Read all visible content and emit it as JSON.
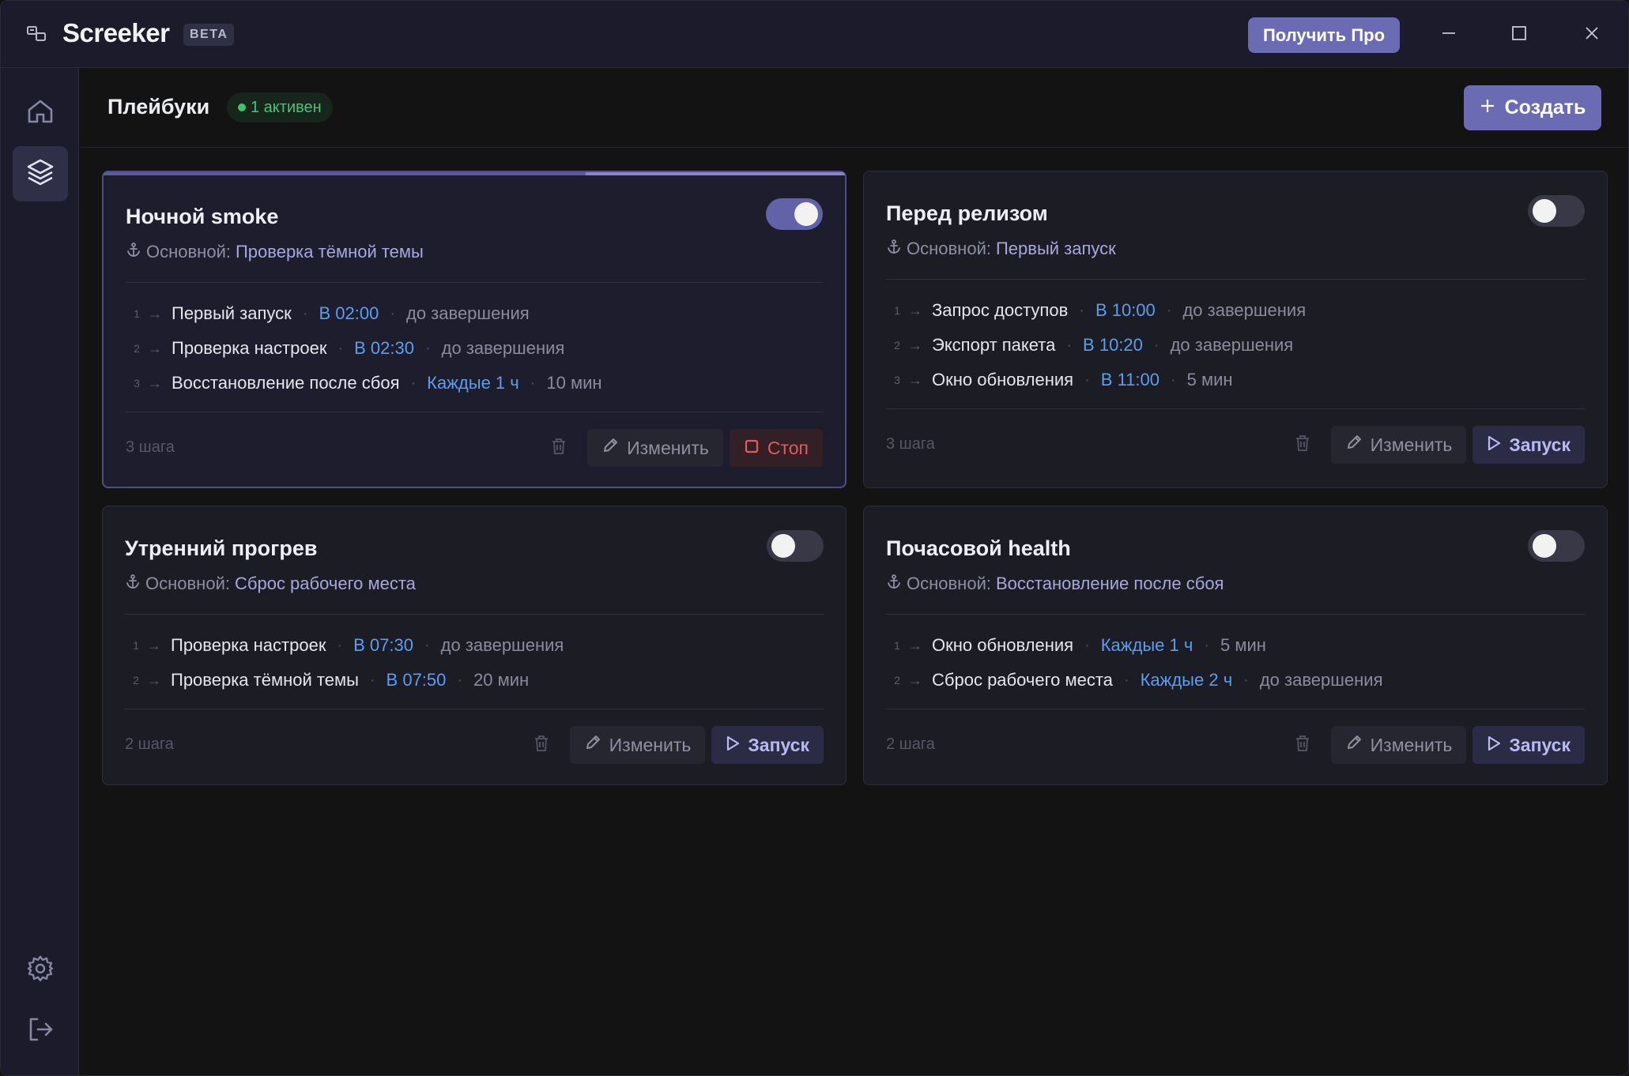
{
  "titlebar": {
    "app_name": "Screeker",
    "beta": "BETA",
    "pro_button": "Получить Про",
    "icons": [
      "app-logo-icon",
      "minimize-icon",
      "maximize-icon",
      "close-icon"
    ]
  },
  "sidebar": {
    "items": [
      {
        "name": "home",
        "icon": "home-icon",
        "active": false
      },
      {
        "name": "playbooks",
        "icon": "layers-icon",
        "active": true
      },
      {
        "name": "settings",
        "icon": "gear-icon",
        "active": false
      },
      {
        "name": "logout",
        "icon": "logout-icon",
        "active": false
      }
    ]
  },
  "header": {
    "title": "Плейбуки",
    "active_badge": "1 активен",
    "create_button": "Создать"
  },
  "labels": {
    "main_prefix": "Основной:",
    "edit": "Изменить",
    "run": "Запуск",
    "stop": "Стоп"
  },
  "cards": [
    {
      "title": "Ночной smoke",
      "enabled": true,
      "running": true,
      "progress": 0.65,
      "main": "Проверка тёмной темы",
      "steps": [
        {
          "num": "1",
          "name": "Первый запуск",
          "when": "В 02:00",
          "duration": "до завершения"
        },
        {
          "num": "2",
          "name": "Проверка настроек",
          "when": "В 02:30",
          "duration": "до завершения"
        },
        {
          "num": "3",
          "name": "Восстановление после сбоя",
          "when": "Каждые 1 ч",
          "duration": "10 мин"
        }
      ],
      "steps_count": "3 шага"
    },
    {
      "title": "Перед релизом",
      "enabled": false,
      "running": false,
      "main": "Первый запуск",
      "steps": [
        {
          "num": "1",
          "name": "Запрос доступов",
          "when": "В 10:00",
          "duration": "до завершения"
        },
        {
          "num": "2",
          "name": "Экспорт пакета",
          "when": "В 10:20",
          "duration": "до завершения"
        },
        {
          "num": "3",
          "name": "Окно обновления",
          "when": "В 11:00",
          "duration": "5 мин"
        }
      ],
      "steps_count": "3 шага"
    },
    {
      "title": "Утренний прогрев",
      "enabled": false,
      "running": false,
      "main": "Сброс рабочего места",
      "steps": [
        {
          "num": "1",
          "name": "Проверка настроек",
          "when": "В 07:30",
          "duration": "до завершения"
        },
        {
          "num": "2",
          "name": "Проверка тёмной темы",
          "when": "В 07:50",
          "duration": "20 мин"
        }
      ],
      "steps_count": "2 шага"
    },
    {
      "title": "Почасовой health",
      "enabled": false,
      "running": false,
      "main": "Восстановление после сбоя",
      "steps": [
        {
          "num": "1",
          "name": "Окно обновления",
          "when": "Каждые 1 ч",
          "duration": "5 мин"
        },
        {
          "num": "2",
          "name": "Сброс рабочего места",
          "when": "Каждые 2 ч",
          "duration": "до завершения"
        }
      ],
      "steps_count": "2 шага"
    }
  ]
}
